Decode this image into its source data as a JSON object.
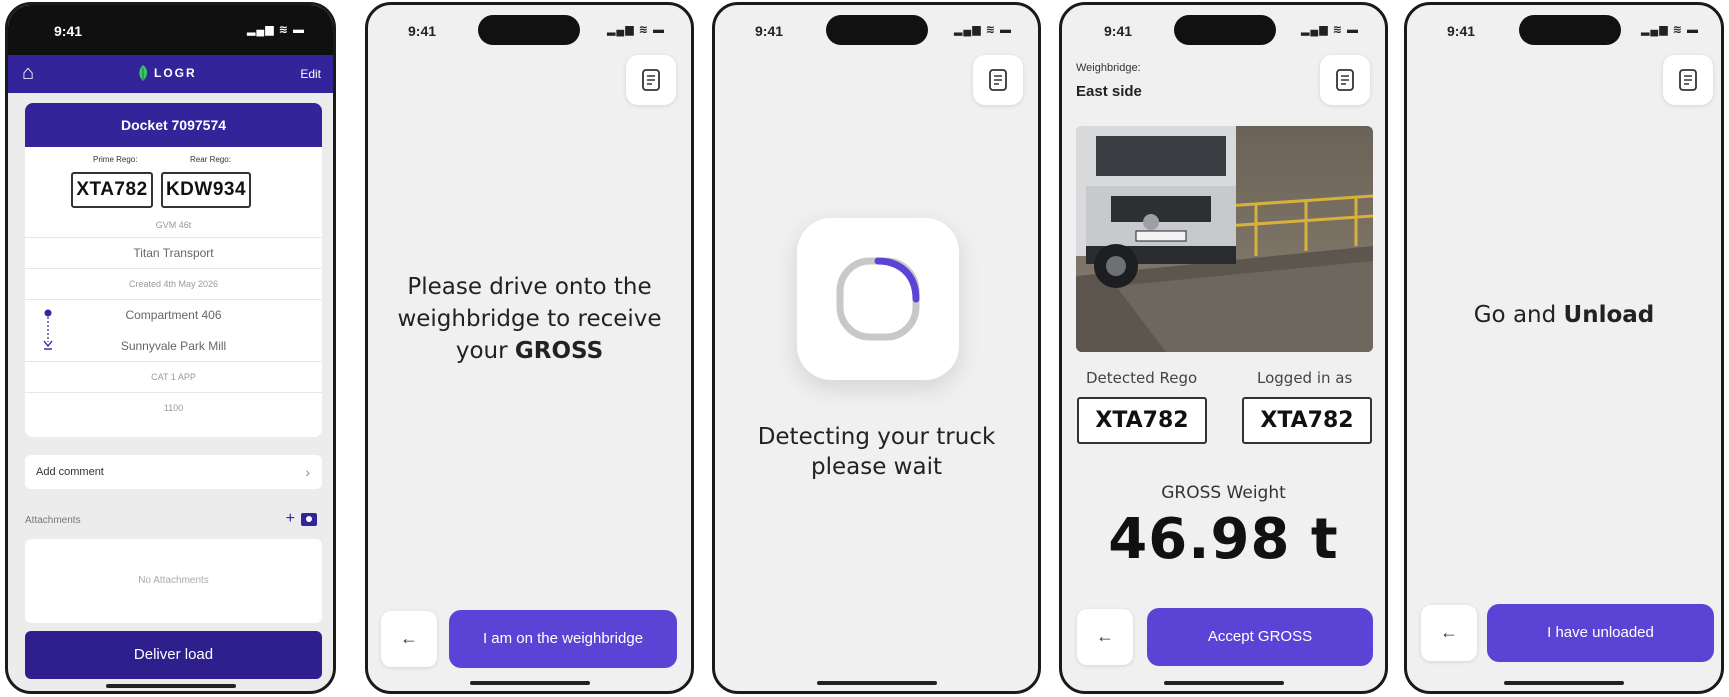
{
  "status_time": "9:41",
  "status_icons": "▂▄▆ ≋ ▬",
  "screen1": {
    "edit_label": "Edit",
    "logo_text": "LOGR",
    "docket_title": "Docket  7097574",
    "prime_rego_label": "Prime Rego:",
    "prime_rego": "XTA782",
    "rear_rego_label": "Rear Rego:",
    "rear_rego": "KDW934",
    "gvm": "GVM 46t",
    "transport": "Titan Transport",
    "created": "Created 4th May 2026",
    "from": "Compartment 406",
    "to": "Sunnyvale Park Mill",
    "category": "CAT 1 APP",
    "code": "1100",
    "add_comment": "Add comment",
    "attachments_label": "Attachments",
    "no_attachments": "No Attachments",
    "deliver_button": "Deliver load"
  },
  "screen2": {
    "line1": "Please drive onto the",
    "line2": "weighbridge to receive",
    "line3_prefix": "your ",
    "line3_bold": "GROSS",
    "primary_button": "I am on the weighbridge"
  },
  "screen3": {
    "line1": "Detecting your truck",
    "line2": "please wait"
  },
  "screen4": {
    "weighbridge_label": "Weighbridge:",
    "weighbridge_value": "East side",
    "detected_rego_label": "Detected Rego",
    "detected_rego": "XTA782",
    "logged_in_label": "Logged in as",
    "logged_in_rego": "XTA782",
    "gross_label": "GROSS Weight",
    "gross_value": "46.98 t",
    "primary_button": "Accept GROSS"
  },
  "screen5": {
    "text_prefix": "Go and ",
    "text_bold": "Unload",
    "primary_button": "I have unloaded"
  },
  "colors": {
    "brand_dark": "#33249a",
    "brand_button": "#5b43d6",
    "spinner_accent": "#5b43d6"
  }
}
